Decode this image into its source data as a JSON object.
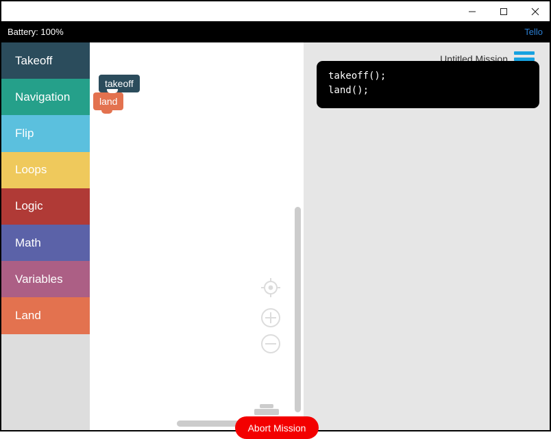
{
  "window": {
    "minimize_icon": "minimize-icon",
    "maximize_icon": "maximize-icon",
    "close_icon": "close-icon"
  },
  "status_bar": {
    "battery_text": "Battery: 100%",
    "device_name": "Tello",
    "device_color": "#2b7fd4",
    "background": "#000000"
  },
  "toolbox": {
    "categories": [
      {
        "label": "Takeoff",
        "color": "#2B4C5C"
      },
      {
        "label": "Navigation",
        "color": "#25A08A"
      },
      {
        "label": "Flip",
        "color": "#5BC0DE"
      },
      {
        "label": "Loops",
        "color": "#EFC95C"
      },
      {
        "label": "Logic",
        "color": "#B03A36"
      },
      {
        "label": "Math",
        "color": "#5B62A8"
      },
      {
        "label": "Variables",
        "color": "#AC5F85"
      },
      {
        "label": "Land",
        "color": "#E3724F"
      }
    ]
  },
  "workspace": {
    "blocks": [
      {
        "label": "takeoff",
        "color": "#2B4C5C"
      },
      {
        "label": "land",
        "color": "#E3724F"
      }
    ],
    "controls": {
      "center_icon": "target-center-icon",
      "zoom_in_icon": "zoom-in-icon",
      "zoom_out_icon": "zoom-out-icon",
      "trash_icon": "trash-can-icon"
    },
    "scrollbar_color": "#cccccc"
  },
  "right_panel": {
    "mission_title": "Untitled Mission",
    "menu_icon": "hamburger-menu-icon",
    "menu_color": "#17A2E0",
    "code_lines": [
      "takeoff();",
      "land();"
    ]
  },
  "abort": {
    "label": "Abort Mission",
    "color": "#F30000"
  }
}
